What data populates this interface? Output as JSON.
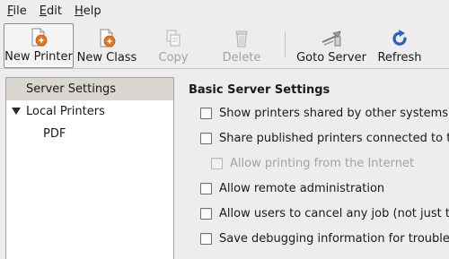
{
  "menubar": {
    "file": {
      "accel": "F",
      "rest": "ile"
    },
    "edit": {
      "accel": "E",
      "rest": "dit"
    },
    "help": {
      "accel": "H",
      "rest": "elp"
    }
  },
  "toolbar": {
    "new_printer": "New Printer",
    "new_class": "New Class",
    "copy": "Copy",
    "delete": "Delete",
    "goto_server": "Goto Server",
    "refresh": "Refresh"
  },
  "tree": {
    "server_settings": "Server Settings",
    "local_printers": "Local Printers",
    "pdf": "PDF"
  },
  "settings": {
    "title": "Basic Server Settings",
    "show_shared": "Show printers shared by other systems",
    "share_published": "Share published printers connected to th",
    "allow_internet": "Allow printing from the Internet",
    "allow_remote_admin": "Allow remote administration",
    "allow_cancel": "Allow users to cancel any job (not just the",
    "save_debug": "Save debugging information for troublesh"
  },
  "colors": {
    "accent_orange": "#e8751a",
    "refresh_blue": "#2a62b8",
    "selection_bg": "#d9d5d0"
  }
}
